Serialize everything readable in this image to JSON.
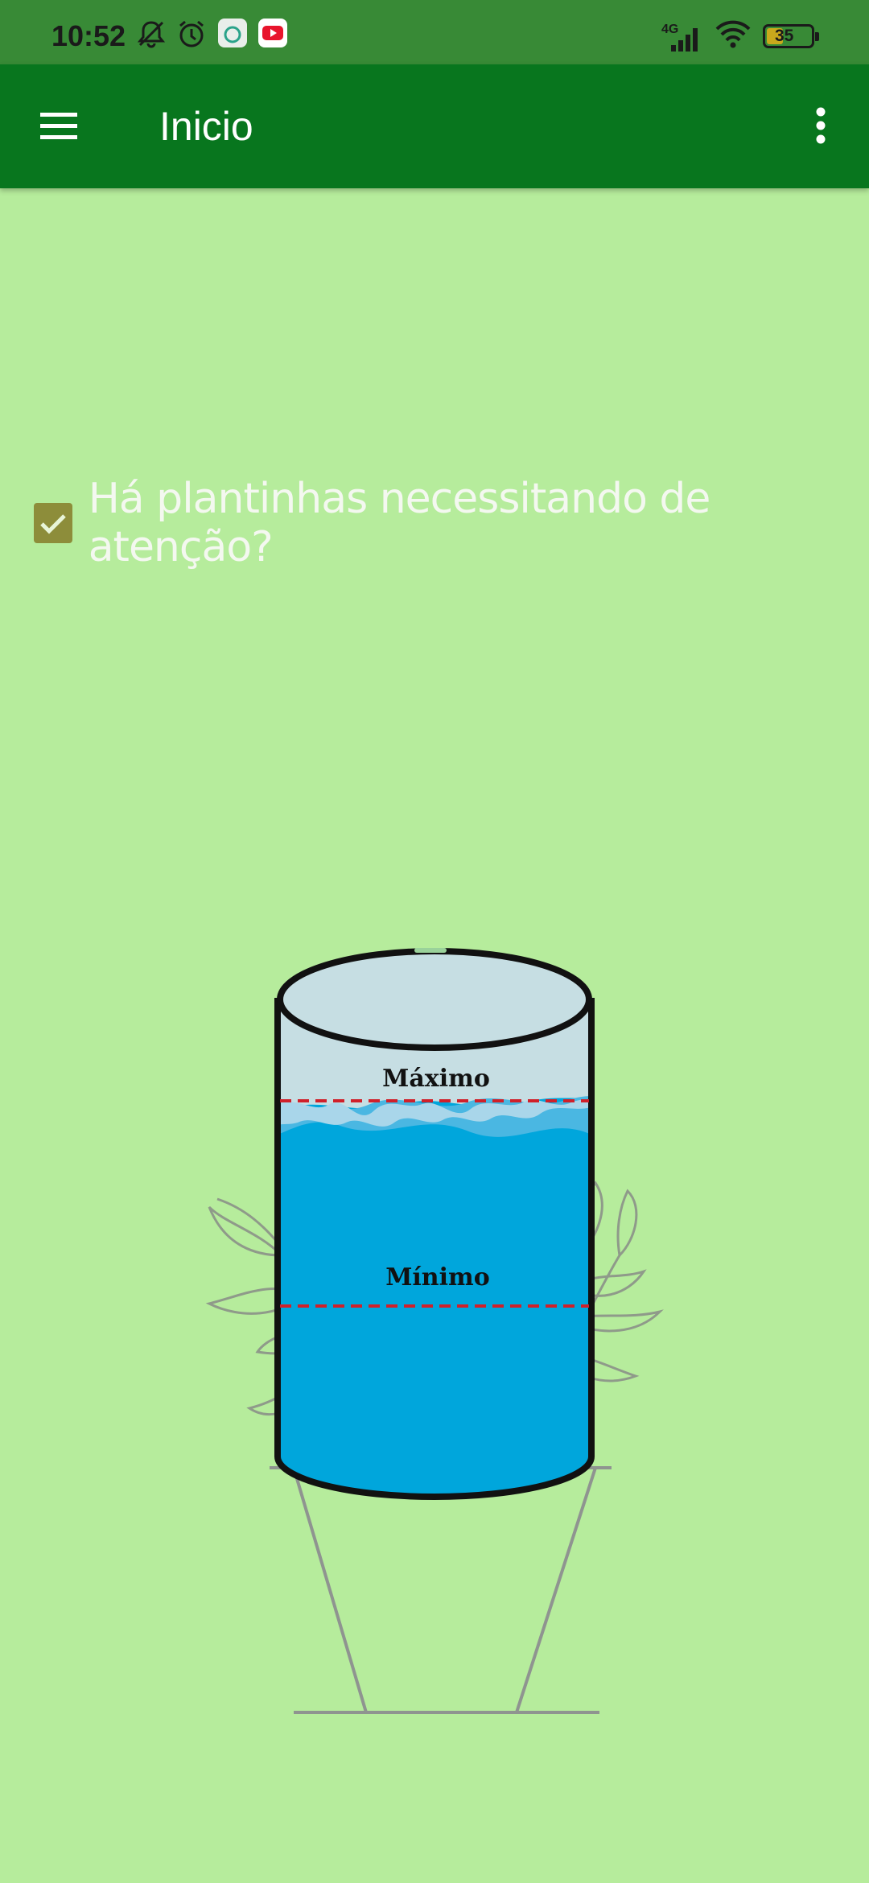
{
  "status_bar": {
    "time": "10:52",
    "network": "4G",
    "battery": "35",
    "icons": [
      "mute-icon",
      "alarm-icon",
      "app-notification-icon",
      "youtube-icon",
      "signal-icon",
      "wifi-icon",
      "battery-icon"
    ]
  },
  "app_bar": {
    "title": "Inicio",
    "menu_icon": "hamburger-menu-icon",
    "overflow_icon": "more-vert-icon",
    "color": "#08761e"
  },
  "main": {
    "attention_checkbox": {
      "label": "Há plantinhas necessitando de atenção?",
      "checked": true
    },
    "tank": {
      "max_label": "Máximo",
      "min_label": "Mínimo",
      "water_color": "#00a6dc"
    },
    "background_color": "#b6ec9c"
  }
}
